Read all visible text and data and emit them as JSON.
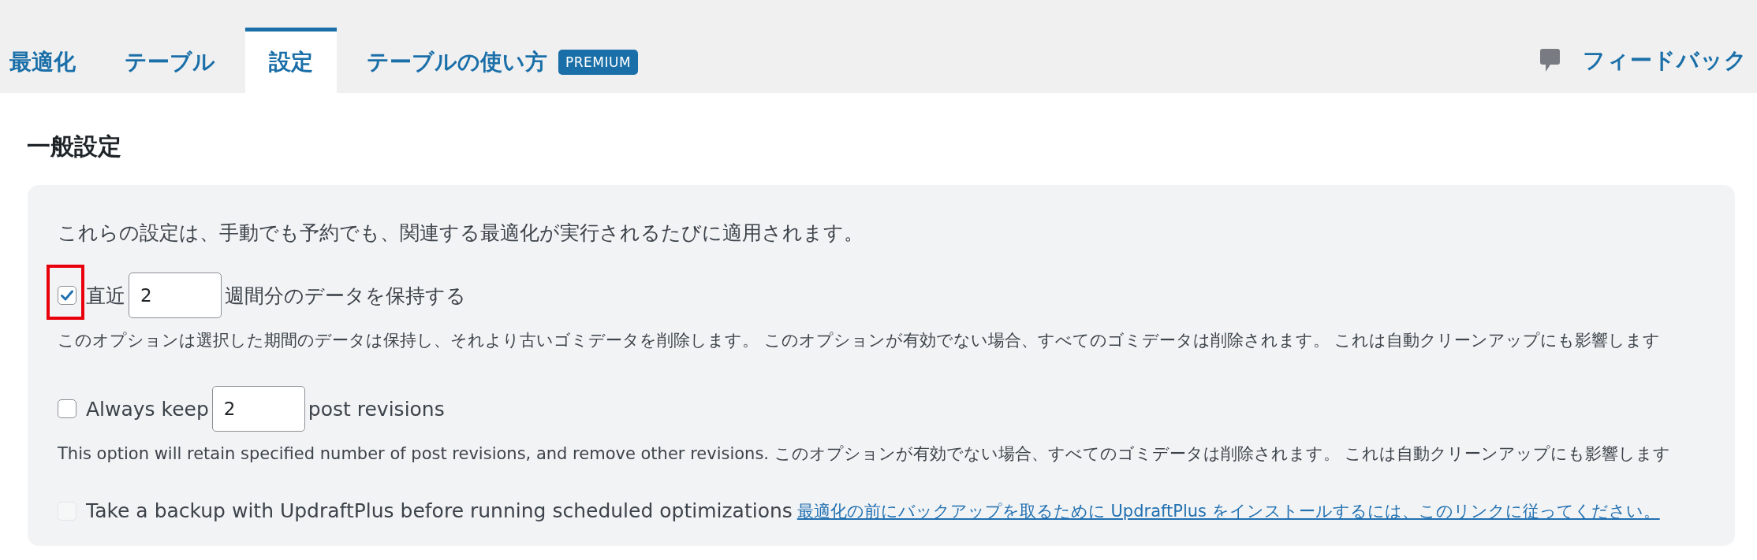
{
  "tabs": [
    {
      "label": "最適化",
      "selected": false
    },
    {
      "label": "テーブル",
      "selected": false
    },
    {
      "label": "設定",
      "selected": true
    },
    {
      "label": "テーブルの使い方",
      "selected": false,
      "badge": "PREMIUM"
    }
  ],
  "feedback": {
    "label": "フィードバック"
  },
  "section_title": "一般設定",
  "card": {
    "intro": "これらの設定は、手動でも予約でも、関連する最適化が実行されるたびに適用されます。",
    "options": [
      {
        "kind": "number",
        "checked": true,
        "disabled": false,
        "highlighted": true,
        "label_before": "直近",
        "value": "2",
        "label_after": "週間分のデータを保持する",
        "description": "このオプションは選択した期間のデータは保持し、それより古いゴミデータを削除します。 このオプションが有効でない場合、すべてのゴミデータは削除されます。 これは自動クリーンアップにも影響します"
      },
      {
        "kind": "number",
        "checked": false,
        "disabled": false,
        "highlighted": false,
        "label_before": "Always keep",
        "value": "2",
        "label_after": "post revisions",
        "description": "This option will retain specified number of post revisions, and remove other revisions. このオプションが有効でない場合、すべてのゴミデータは削除されます。 これは自動クリーンアップにも影響します"
      },
      {
        "kind": "link",
        "checked": false,
        "disabled": true,
        "highlighted": false,
        "label": "Take a backup with UpdraftPlus before running scheduled optimizations",
        "link": "最適化の前にバックアップを取るために UpdraftPlus をインストールするには、このリンクに従ってください。"
      }
    ]
  }
}
